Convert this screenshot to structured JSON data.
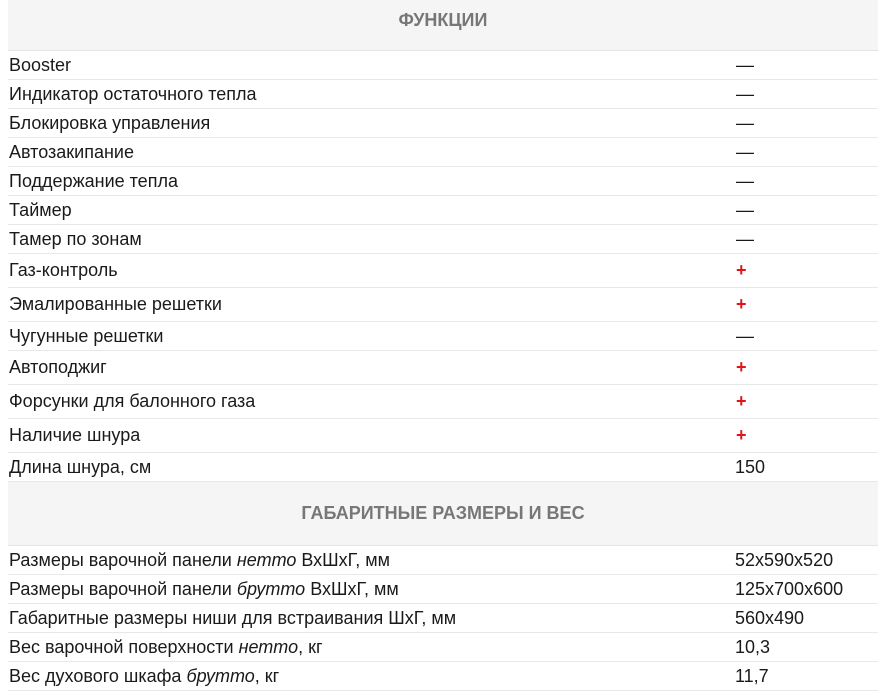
{
  "sections": [
    {
      "title": "ФУНКЦИИ",
      "rows": [
        {
          "label": "Booster",
          "value": "—",
          "kind": "dash",
          "h": 29
        },
        {
          "label": "Индикатор остаточного тепла",
          "value": "—",
          "kind": "dash",
          "h": 29
        },
        {
          "label": "Блокировка управления",
          "value": "—",
          "kind": "dash",
          "h": 29
        },
        {
          "label": "Автозакипание",
          "value": "—",
          "kind": "dash",
          "h": 29
        },
        {
          "label": "Поддержание тепла",
          "value": "—",
          "kind": "dash",
          "h": 29
        },
        {
          "label": "Таймер",
          "value": "—",
          "kind": "dash",
          "h": 29
        },
        {
          "label": "Тамер по зонам",
          "value": "—",
          "kind": "dash",
          "h": 29
        },
        {
          "label": "Газ-контроль",
          "value": "+",
          "kind": "plus",
          "h": 34
        },
        {
          "label": "Эмалированные решетки",
          "value": "+",
          "kind": "plus",
          "h": 34
        },
        {
          "label": "Чугунные решетки",
          "value": "—",
          "kind": "dash",
          "h": 29
        },
        {
          "label": "Автоподжиг",
          "value": "+",
          "kind": "plus",
          "h": 34
        },
        {
          "label": "Форсунки для балонного газа",
          "value": "+",
          "kind": "plus",
          "h": 34
        },
        {
          "label": "Наличие шнура",
          "value": "+",
          "kind": "plus",
          "h": 34
        },
        {
          "label": "Длина шнура, см",
          "value": "150",
          "kind": "text",
          "h": 29
        }
      ]
    },
    {
      "title": "ГАБАРИТНЫЕ РАЗМЕРЫ И ВЕС",
      "rows": [
        {
          "parts": [
            {
              "t": "Размеры варочной панели "
            },
            {
              "t": "нетто",
              "i": true
            },
            {
              "t": " ВхШхГ, мм"
            }
          ],
          "value": "52x590x520",
          "kind": "text",
          "h": 29
        },
        {
          "parts": [
            {
              "t": "Размеры варочной панели "
            },
            {
              "t": "брутто",
              "i": true
            },
            {
              "t": " ВхШхГ, мм"
            }
          ],
          "value": "125x700x600",
          "kind": "text",
          "h": 29
        },
        {
          "parts": [
            {
              "t": "Габаритные размеры ниши для встраивания ШхГ, мм"
            }
          ],
          "value": "560x490",
          "kind": "text",
          "h": 29
        },
        {
          "parts": [
            {
              "t": "Вес варочной поверхности "
            },
            {
              "t": "нетто",
              "i": true
            },
            {
              "t": ", кг"
            }
          ],
          "value": "10,3",
          "kind": "text",
          "h": 29
        },
        {
          "parts": [
            {
              "t": "Вес духового шкафа "
            },
            {
              "t": "брутто",
              "i": true
            },
            {
              "t": ", кг"
            }
          ],
          "value": "11,7",
          "kind": "text",
          "h": 29
        }
      ]
    }
  ]
}
